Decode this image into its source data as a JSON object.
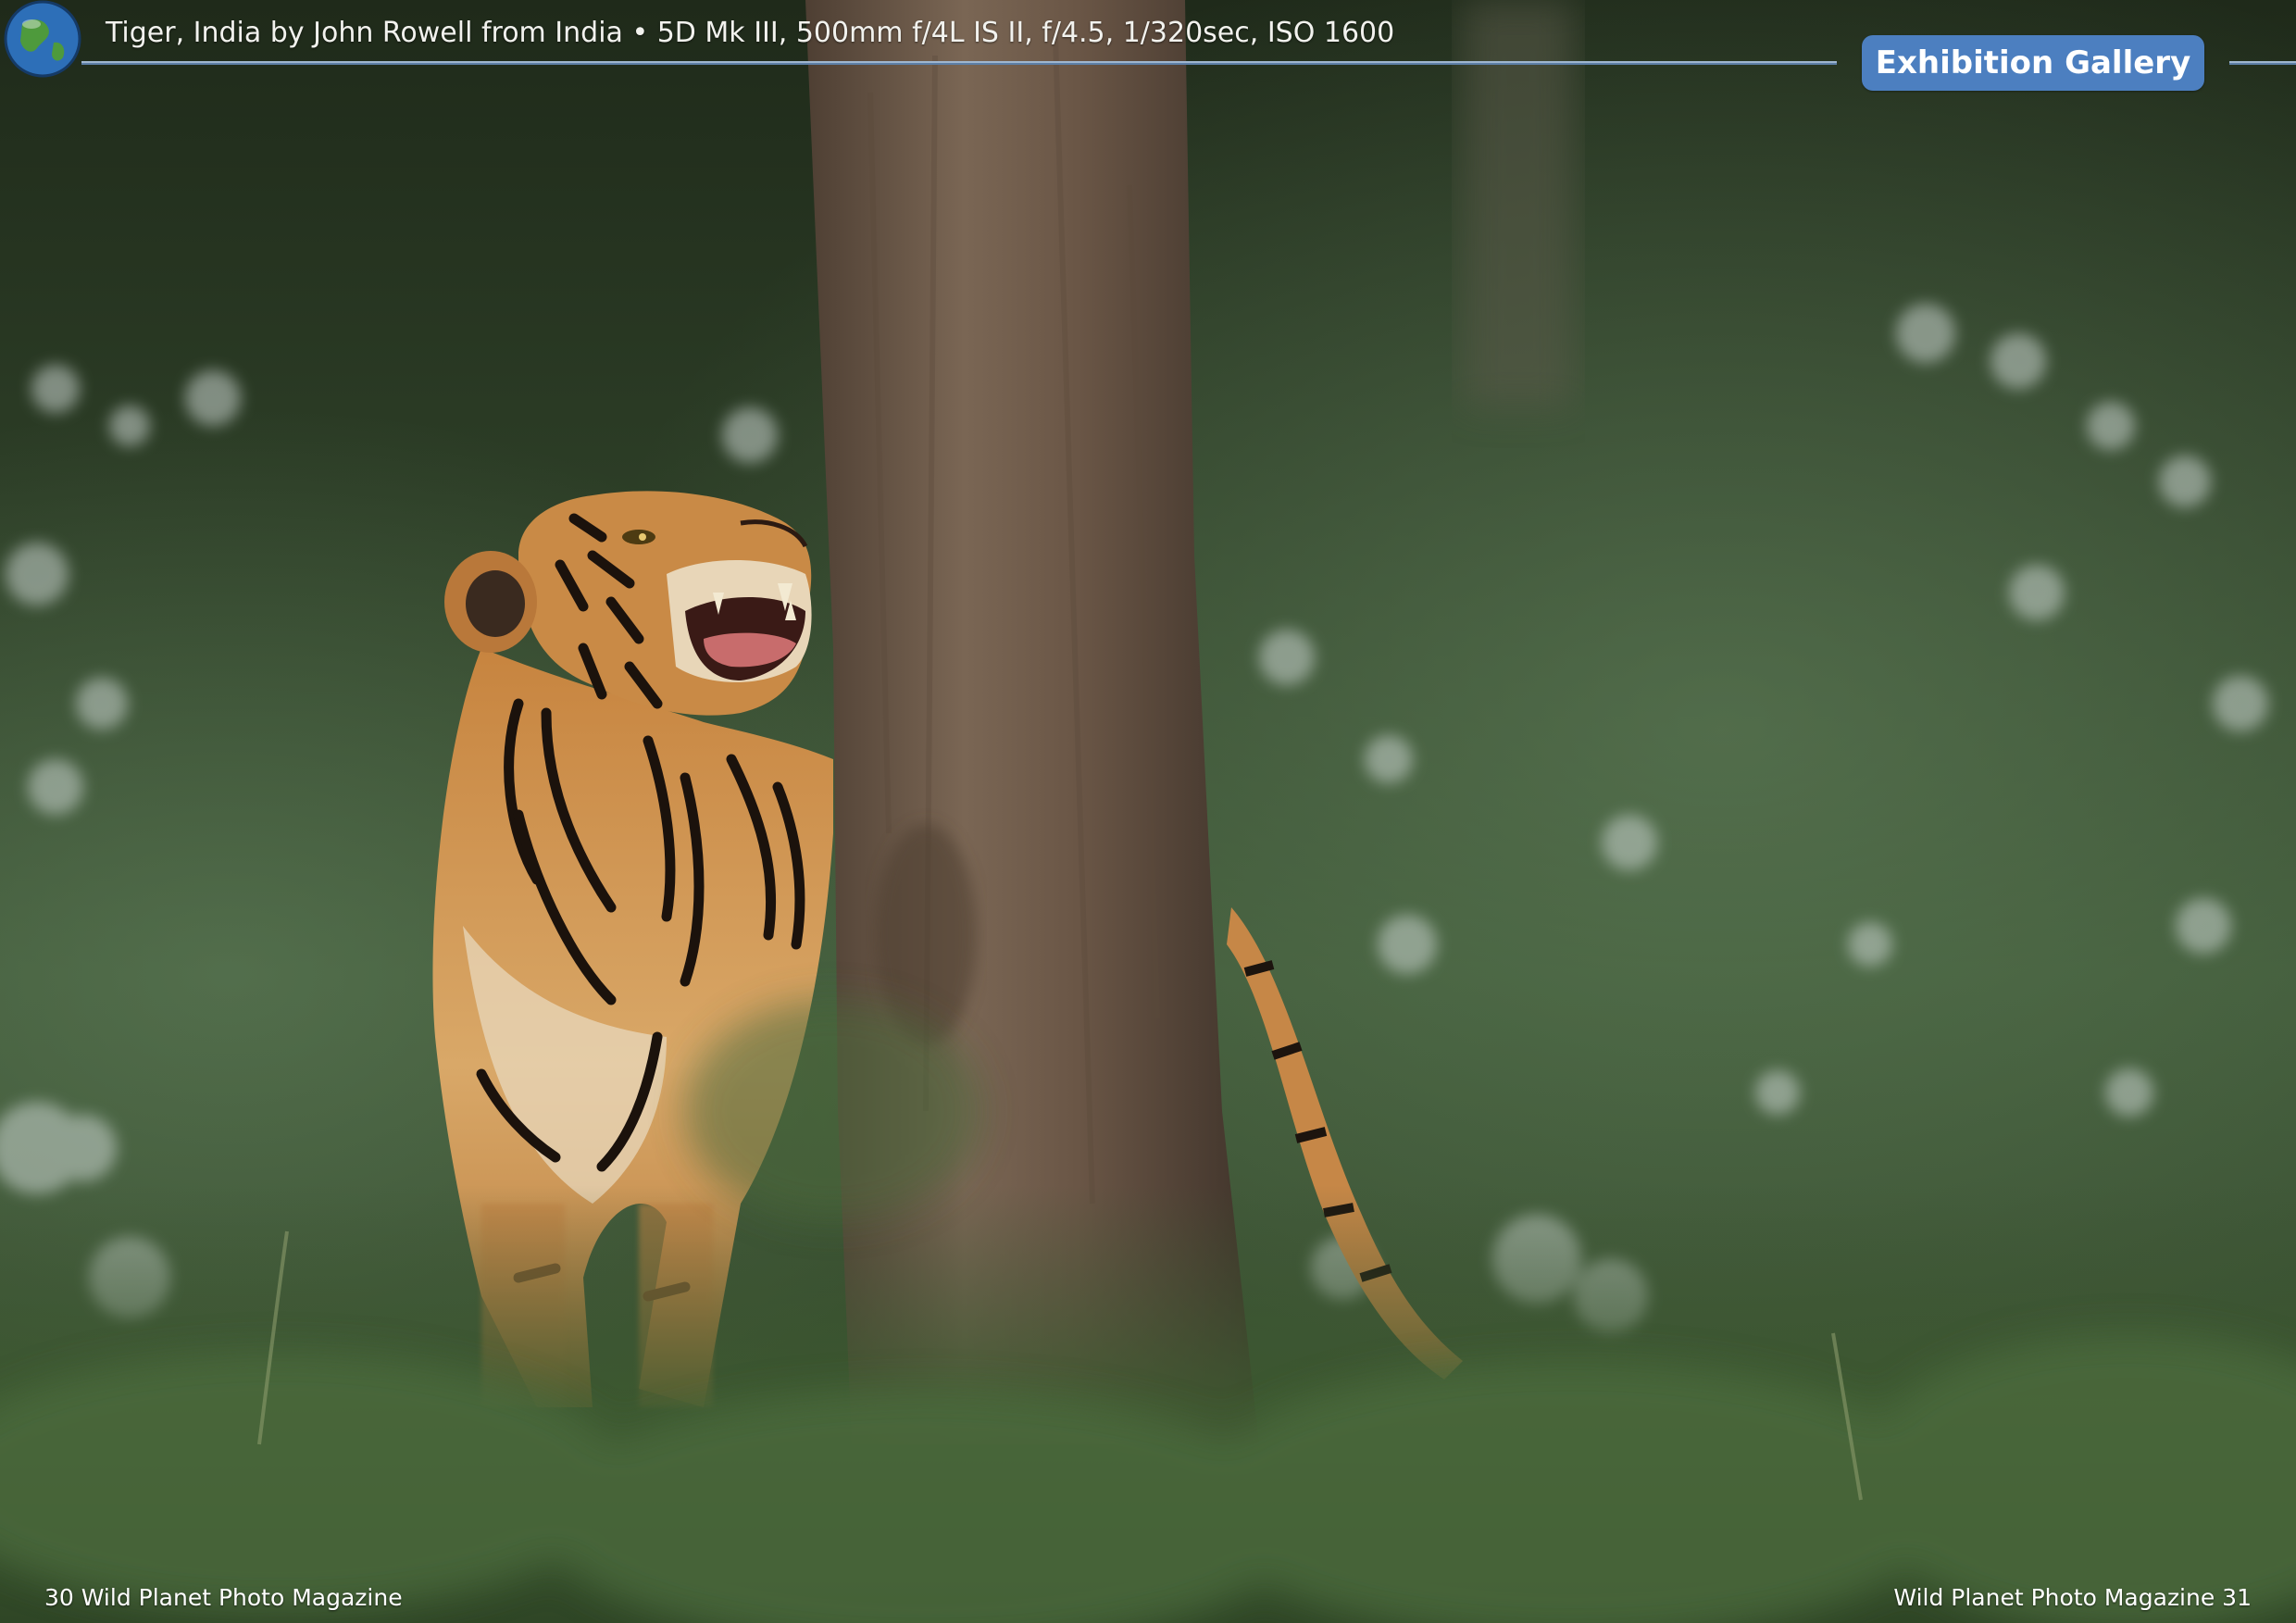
{
  "header": {
    "caption": "Tiger, India by John Rowell from India • 5D Mk III, 500mm f/4L IS II, f/4.5, 1/320sec, ISO 1600",
    "badge_label": "Exhibition Gallery",
    "globe_icon": "globe-icon"
  },
  "photo": {
    "subject": "tiger",
    "colors": {
      "foliage": "#3f5a36",
      "trunk": "#6e5a48",
      "tiger_orange": "#c8843e",
      "badge": "#4c7fc0"
    }
  },
  "footer": {
    "left_page": "30 Wild Planet Photo Magazine",
    "right_page": "Wild Planet Photo Magazine 31"
  }
}
